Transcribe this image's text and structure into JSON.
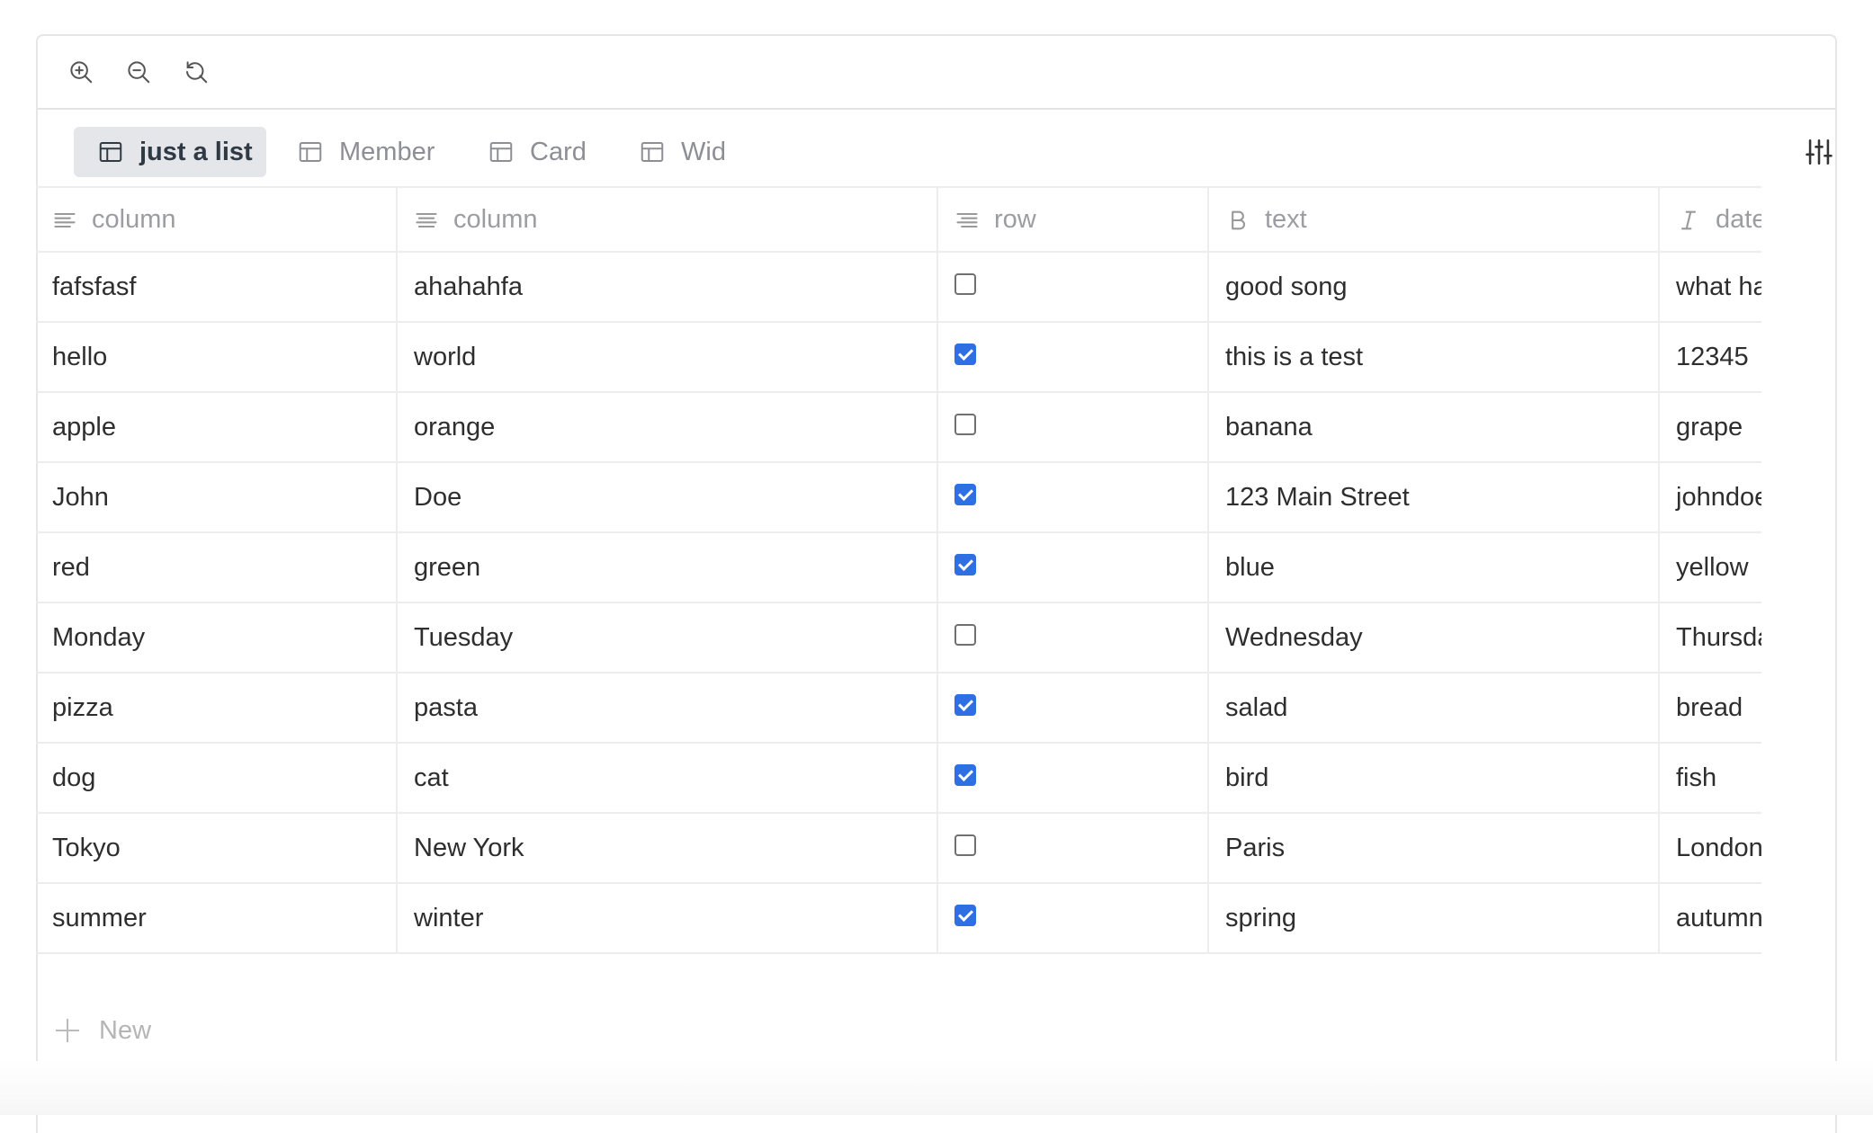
{
  "toolbar": {
    "zoom_in_icon": "zoom-in-icon",
    "zoom_out_icon": "zoom-out-icon",
    "reset_icon": "reset-icon"
  },
  "views": {
    "tabs": [
      {
        "label": "just a list",
        "active": true,
        "icon": "table-icon"
      },
      {
        "label": "Member",
        "active": false,
        "icon": "table-icon"
      },
      {
        "label": "Card",
        "active": false,
        "icon": "table-icon"
      },
      {
        "label": "Wid",
        "active": false,
        "icon": "table-icon"
      }
    ],
    "settings_icon": "sliders-icon"
  },
  "table": {
    "columns": [
      {
        "label": "column",
        "icon": "text-align-left-icon"
      },
      {
        "label": "column",
        "icon": "text-align-center-icon"
      },
      {
        "label": "row",
        "icon": "text-align-right-icon"
      },
      {
        "label": "text",
        "icon": "bold-icon"
      },
      {
        "label": "date",
        "icon": "italic-icon"
      }
    ],
    "rows": [
      {
        "c1": "fafsfasf",
        "c2": "ahahahfa",
        "checked": false,
        "c4": "good song",
        "c5": "what happened"
      },
      {
        "c1": "hello",
        "c2": "world",
        "checked": true,
        "c4": "this is a test",
        "c5": "12345"
      },
      {
        "c1": "apple",
        "c2": "orange",
        "checked": false,
        "c4": "banana",
        "c5": "grape"
      },
      {
        "c1": "John",
        "c2": "Doe",
        "checked": true,
        "c4": "123 Main Street",
        "c5": "johndoe"
      },
      {
        "c1": "red",
        "c2": "green",
        "checked": true,
        "c4": "blue",
        "c5": "yellow"
      },
      {
        "c1": "Monday",
        "c2": "Tuesday",
        "checked": false,
        "c4": "Wednesday",
        "c5": "Thursday"
      },
      {
        "c1": "pizza",
        "c2": "pasta",
        "checked": true,
        "c4": "salad",
        "c5": "bread"
      },
      {
        "c1": "dog",
        "c2": "cat",
        "checked": true,
        "c4": "bird",
        "c5": "fish"
      },
      {
        "c1": "Tokyo",
        "c2": "New York",
        "checked": false,
        "c4": "Paris",
        "c5": "London"
      },
      {
        "c1": "summer",
        "c2": "winter",
        "checked": true,
        "c4": "spring",
        "c5": "autumn"
      }
    ]
  },
  "new_row": {
    "label": "New"
  },
  "colors": {
    "accent": "#2f6fe4",
    "active_tab_bg": "#e4e6ea",
    "border": "#ededed"
  }
}
